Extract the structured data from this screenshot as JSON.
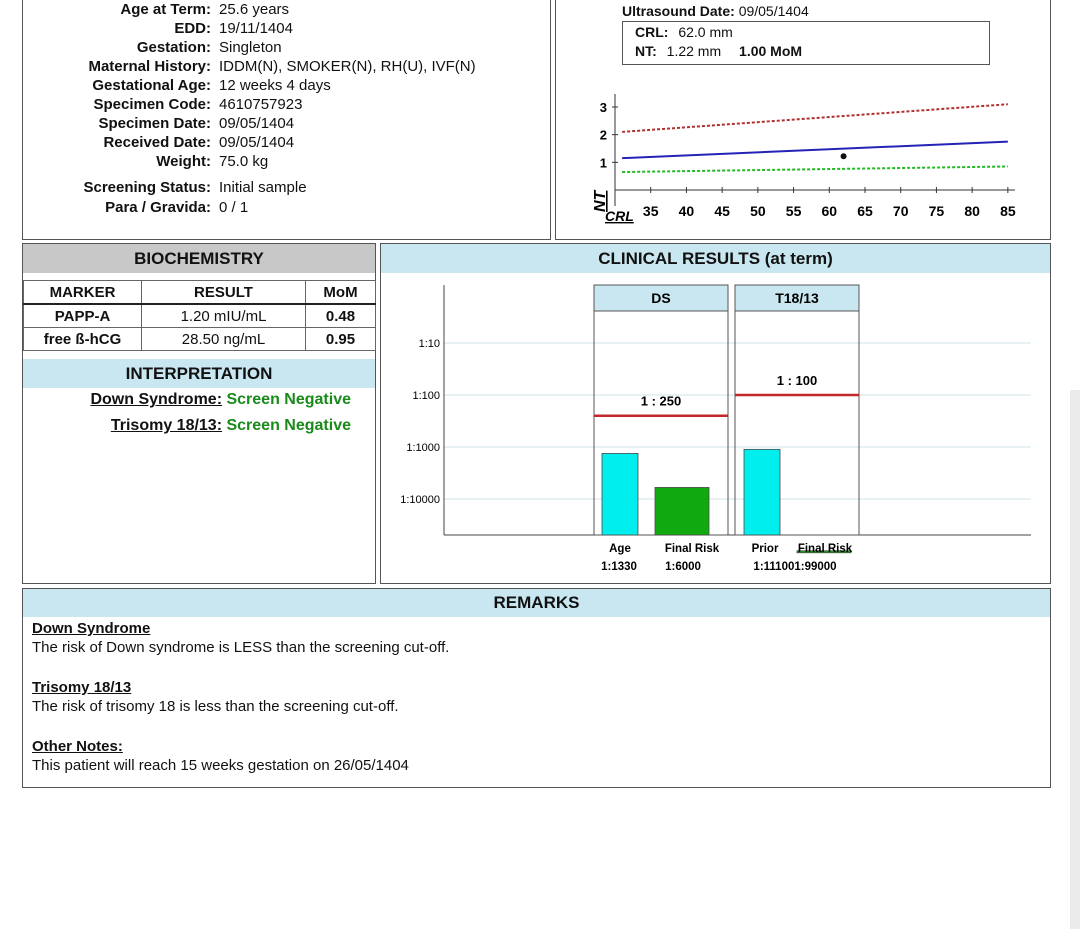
{
  "patient": {
    "rows": [
      {
        "label": "Age at Term:",
        "value": "25.6 years"
      },
      {
        "label": "EDD:",
        "value": "19/11/1404"
      },
      {
        "label": "Gestation:",
        "value": "Singleton"
      },
      {
        "label": "Maternal History:",
        "value": "IDDM(N), SMOKER(N), RH(U), IVF(N)"
      },
      {
        "label": "Gestational Age:",
        "value": "12 weeks 4 days"
      },
      {
        "label": "Specimen Code:",
        "value": "4610757923"
      },
      {
        "label": "Specimen Date:",
        "value": "09/05/1404"
      },
      {
        "label": "Received Date:",
        "value": "09/05/1404"
      },
      {
        "label": "Weight:",
        "value": "75.0 kg"
      },
      {
        "label": "Screening Status:",
        "value": "Initial sample"
      },
      {
        "label": "Para / Gravida:",
        "value": "0 / 1"
      }
    ]
  },
  "ultrasound": {
    "date_label": "Ultrasound Date:",
    "date_value": "09/05/1404",
    "crl_label": "CRL:",
    "crl_value": "62.0 mm",
    "nt_label": "NT:",
    "nt_value": "1.22 mm",
    "nt_mom": "1.00 MoM"
  },
  "biochemistry": {
    "title": "BIOCHEMISTRY",
    "headers": [
      "MARKER",
      "RESULT",
      "MoM"
    ],
    "rows": [
      {
        "marker": "PAPP-A",
        "result": "1.20 mIU/mL",
        "mom": "0.48"
      },
      {
        "marker": "free ß-hCG",
        "result": "28.50 ng/mL",
        "mom": "0.95"
      }
    ]
  },
  "interpretation": {
    "title": "INTERPRETATION",
    "items": [
      {
        "label": "Down Syndrome:",
        "result": "Screen Negative"
      },
      {
        "label": "Trisomy 18/13:",
        "result": "Screen Negative"
      }
    ]
  },
  "clinical": {
    "title": "CLINICAL RESULTS (at term)",
    "panels": [
      {
        "title": "DS",
        "cutoff_label": "1 : 250",
        "bar_labels": [
          "Age",
          "Final Risk"
        ],
        "bar_values": [
          "1:1330",
          "1:6000"
        ]
      },
      {
        "title": "T18/13",
        "cutoff_label": "1 : 100",
        "bar_labels": [
          "Prior",
          "Final Risk"
        ],
        "bar_values": [
          "1:111001:99000"
        ]
      }
    ]
  },
  "remarks": {
    "title": "REMARKS",
    "sections": [
      {
        "heading": "Down Syndrome",
        "text": "The risk of Down syndrome is LESS than the screening cut-off."
      },
      {
        "heading": "Trisomy 18/13",
        "text": "The risk of trisomy 18 is less than the screening cut-off."
      },
      {
        "heading": "Other Notes:",
        "text": "This patient will reach 15 weeks gestation on 26/05/1404"
      }
    ]
  },
  "colors": {
    "header_bg": "#c9e7f0",
    "age_bar": "#00eeee",
    "final_bar": "#10aa10",
    "cutoff": "#c0282a",
    "nt_upper": "#b03030",
    "nt_median": "#2323b5",
    "nt_lower": "#22bb22"
  },
  "chart_data": [
    {
      "type": "line",
      "xlabel": "CRL",
      "ylabel": "NT",
      "x_ticks": [
        35,
        40,
        45,
        50,
        55,
        60,
        65,
        70,
        75,
        80,
        85
      ],
      "y_ticks": [
        1,
        2,
        3
      ],
      "xlim": [
        30,
        86
      ],
      "ylim": [
        0,
        3.5
      ],
      "series": [
        {
          "x": [
            31,
            85
          ],
          "y": [
            2.1,
            3.1
          ],
          "color": "#b03030",
          "style": "dashed"
        },
        {
          "x": [
            31,
            85
          ],
          "y": [
            1.15,
            1.75
          ],
          "color": "#2323b5",
          "style": "solid"
        },
        {
          "x": [
            31,
            85
          ],
          "y": [
            0.65,
            0.85
          ],
          "color": "#22bb22",
          "style": "dashed"
        }
      ],
      "points": [
        {
          "x": 62.0,
          "y": 1.22
        }
      ]
    },
    {
      "type": "bar",
      "y_scale": "log",
      "y_ticks": [
        "1:10",
        "1:100",
        "1:1000",
        "1:10000"
      ],
      "groups": [
        {
          "name": "DS",
          "cutoff_denominator": 250,
          "bars": [
            {
              "category": "Age",
              "risk_denominator": 1330
            },
            {
              "category": "Final Risk",
              "risk_denominator": 6000
            }
          ]
        },
        {
          "name": "T18/13",
          "cutoff_denominator": 100,
          "bars": [
            {
              "category": "Prior",
              "risk_denominator": 1110
            },
            {
              "category": "Final Risk",
              "risk_denominator": 99000
            }
          ]
        }
      ]
    }
  ]
}
